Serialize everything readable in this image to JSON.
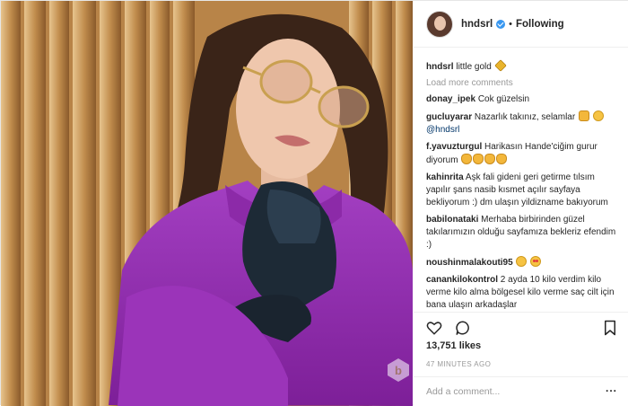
{
  "header": {
    "username": "hndsrl",
    "separator": "•",
    "follow_label": "Following"
  },
  "caption": {
    "username": "hndsrl",
    "text": "little gold"
  },
  "load_more_label": "Load more comments",
  "comments": [
    {
      "user": "donay_ipek",
      "text": "Cok güzelsin",
      "emoji": []
    },
    {
      "user": "gucluyarar",
      "text": "Nazarlık takınız, selamlar",
      "emoji": [
        "thumb",
        "wink"
      ],
      "mention": "@hndsrl"
    },
    {
      "user": "f.yavuzturgul",
      "text": "Harikasın Hande'ciğim gurur diyorum",
      "emoji": [
        "clap",
        "clap",
        "clap",
        "clap"
      ]
    },
    {
      "user": "kahinrita",
      "text": "Aşk fali gideni geri getirme tılsım yapılır şans nasib kısmet açılır sayfaya bekliyorum :) dm ulaşın yildizname bakıyorum",
      "emoji": []
    },
    {
      "user": "babilonataki",
      "text": "Merhaba birbirinden güzel takılarımızın olduğu sayfamıza bekleriz efendim :)",
      "emoji": []
    },
    {
      "user": "noushinmalakouti95",
      "text": "",
      "emoji": [
        "wink",
        "love"
      ]
    },
    {
      "user": "canankilokontrol",
      "text": "2 ayda 10 kilo verdim kilo verme kilo alma bölgesel kilo verme saç cilt için bana ulaşın arkadaşlar",
      "emoji": []
    }
  ],
  "likes_text": "13,751 likes",
  "time_text": "47 MINUTES AGO",
  "add_comment_placeholder": "Add a comment...",
  "more_label": "...",
  "icons": [
    "heart-icon",
    "comment-icon",
    "bookmark-icon",
    "more-options-icon",
    "verified-badge-icon"
  ],
  "colors": {
    "verified": "#3897f0",
    "sweater": "#9a2fb8",
    "background_wood": "#c79a5a"
  }
}
